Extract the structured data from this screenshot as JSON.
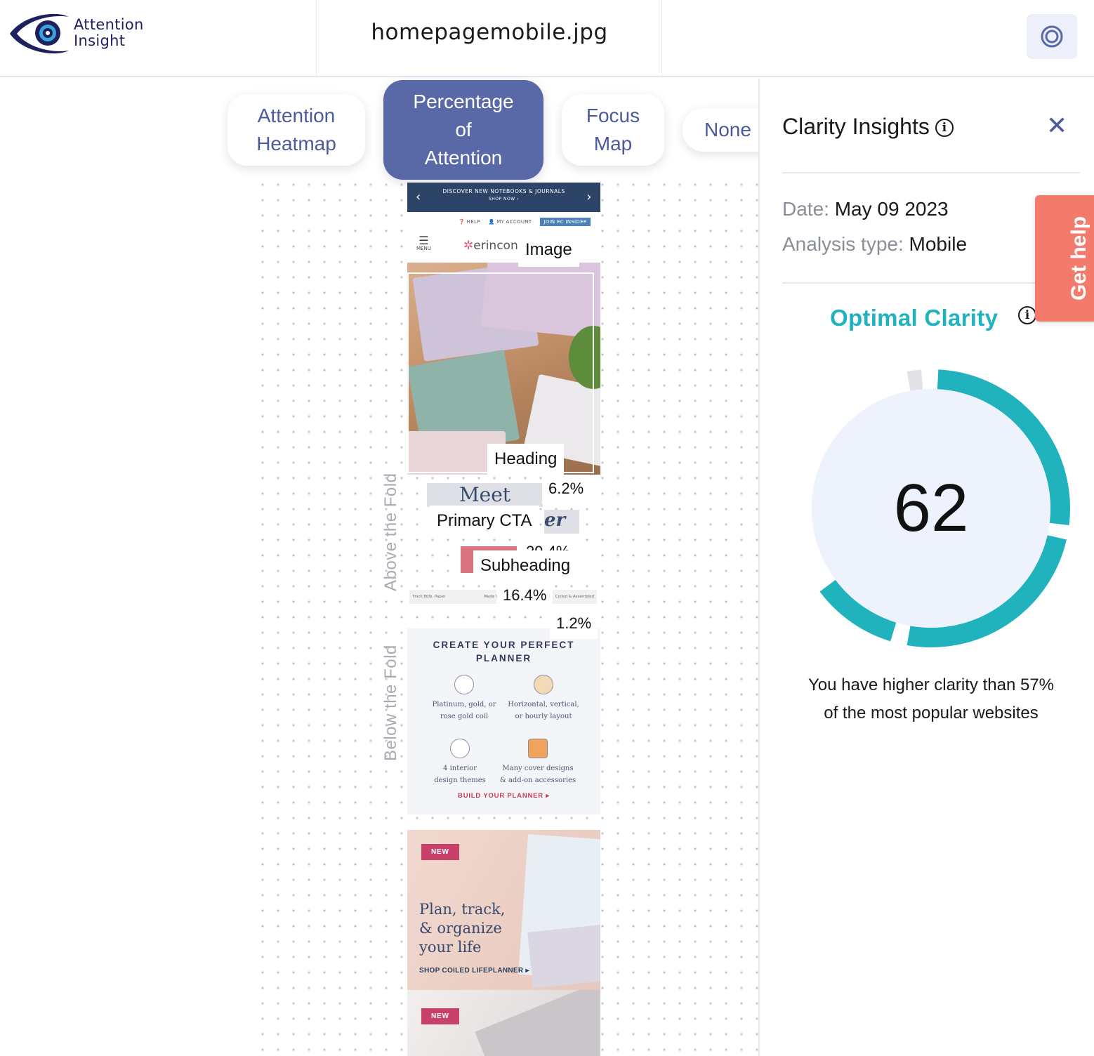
{
  "header": {
    "logo_line1": "Attention",
    "logo_line2": "Insight",
    "file_name": "homepagemobile.jpg",
    "target_icon": "target-icon"
  },
  "tabs": [
    {
      "line1": "Attention",
      "line2": "Heatmap",
      "line3": "",
      "active": false
    },
    {
      "line1": "Percentage",
      "line2": "of",
      "line3": "Attention",
      "active": true
    },
    {
      "line1": "Focus",
      "line2": "Map",
      "line3": "",
      "active": false
    },
    {
      "line1": "None",
      "line2": "",
      "line3": "",
      "active": false
    }
  ],
  "fold": {
    "above": "Above the Fold",
    "below": "Below the Fold"
  },
  "screenshot": {
    "promo_text": "DISCOVER NEW NOTEBOOKS & JOURNALS",
    "promo_sub": "SHOP NOW",
    "help": "HELP",
    "account": "MY ACCOUNT",
    "join": "JOIN EC INSIDER",
    "menu": "MENU",
    "brand": "erincon",
    "meet": "Meet",
    "strip_left": "Thick 80lb. Paper",
    "strip_mid": "Made In The USA",
    "strip_right": "Coiled & Assembled",
    "create_title_1": "CREATE YOUR PERFECT",
    "create_title_2": "PLANNER",
    "feature_1a": "Platinum, gold, or",
    "feature_1b": "rose gold coil",
    "feature_2a": "Horizontal, vertical,",
    "feature_2b": "or hourly layout",
    "feature_3a": "4 interior",
    "feature_3b": "design themes",
    "feature_4a": "Many cover designs",
    "feature_4b": "& add-on accessories",
    "build_cta": "BUILD YOUR PLANNER ▸",
    "new_badge": "NEW",
    "promo2_l1": "Plan, track,",
    "promo2_l2": "& organize",
    "promo2_l3": "your life",
    "promo2_cta": "SHOP COILED LIFEPLANNER ▸"
  },
  "aois": [
    {
      "label": "Image",
      "percent": ""
    },
    {
      "label": "Heading",
      "percent": "6.2%"
    },
    {
      "label": "Primary CTA",
      "percent": "29.4%"
    },
    {
      "label": "Subheading",
      "percent": "16.4%"
    },
    {
      "label": "",
      "percent": "1.2%"
    }
  ],
  "panel": {
    "title": "Clarity Insights",
    "date_label": "Date:",
    "date_value": "May 09 2023",
    "type_label": "Analysis type:",
    "type_value": "Mobile",
    "clarity_title": "Optimal Clarity",
    "score": "62",
    "score_max": 100,
    "description_line1": "You have higher clarity than 57%",
    "description_line2": "of the most popular websites",
    "accent_color": "#20b2bd"
  },
  "get_help": "Get help"
}
